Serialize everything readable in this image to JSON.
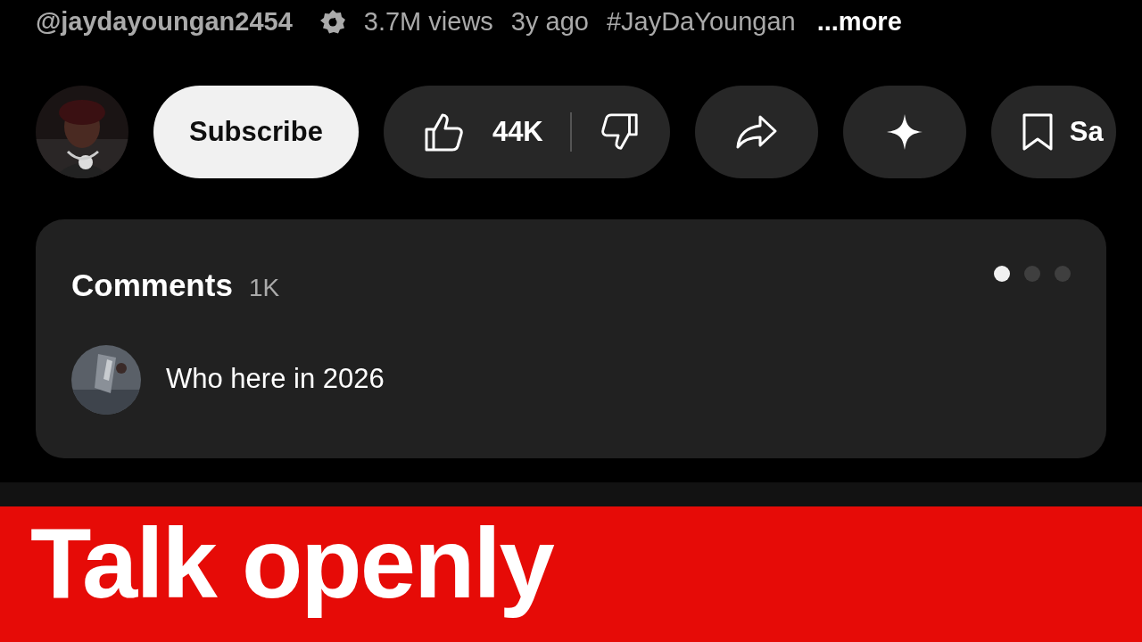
{
  "meta": {
    "channel": "@jaydayoungan2454",
    "verified": true,
    "views": "3.7M views",
    "age": "3y ago",
    "hashtag": "#JayDaYoungan",
    "more": "...more"
  },
  "actions": {
    "subscribe": "Subscribe",
    "likes": "44K",
    "save": "Sa"
  },
  "comments": {
    "title": "Comments",
    "count": "1K",
    "dots": [
      {
        "selected": true
      },
      {
        "selected": false
      },
      {
        "selected": false
      }
    ],
    "top_comment": "Who here in 2026"
  },
  "banner": {
    "text": "Talk openly"
  }
}
